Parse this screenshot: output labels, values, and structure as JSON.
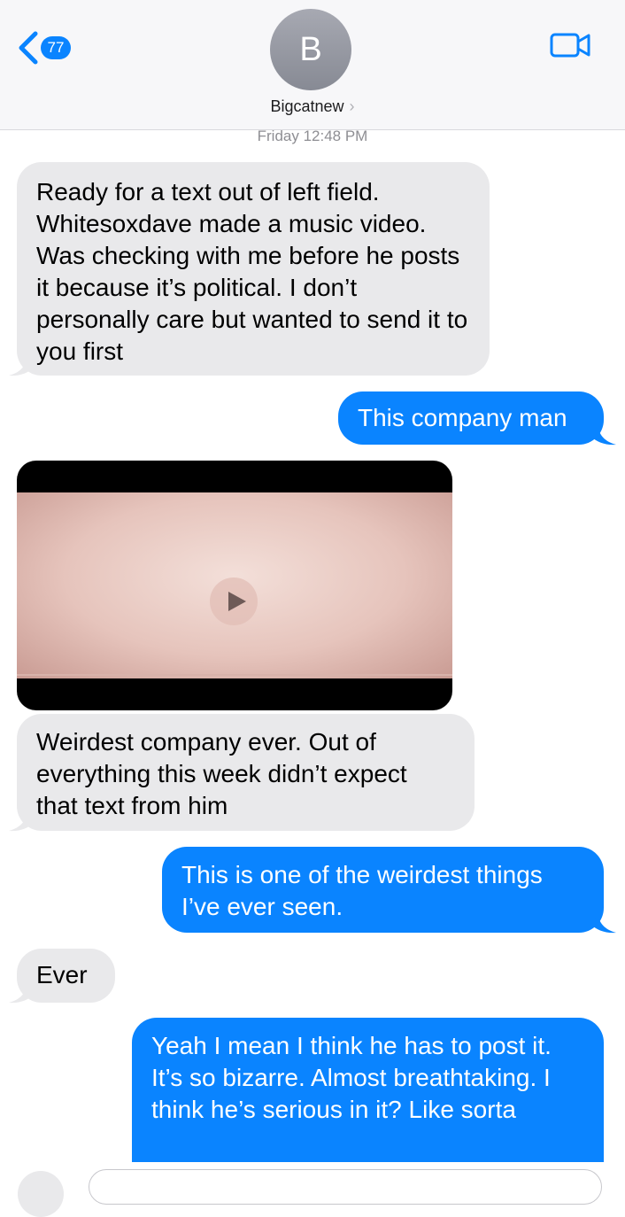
{
  "header": {
    "back_count": "77",
    "avatar_initial": "B",
    "contact_name": "Bigcatnew",
    "contact_chevron": "›",
    "back_icon": "chevron-left-icon",
    "video_call_icon": "video-camera-icon"
  },
  "timestamp": "Friday 12:48 PM",
  "messages": [
    {
      "direction": "incoming",
      "text": "Ready for a text out of left field. Whitesoxdave made a music video. Was checking with me before he posts it because it’s political. I don’t personally care but wanted to send it to you first"
    },
    {
      "direction": "outgoing",
      "text": "This company man"
    },
    {
      "direction": "incoming",
      "type": "video-attachment"
    },
    {
      "direction": "incoming",
      "text": "Weirdest company ever. Out of everything this week didn’t expect that text from him"
    },
    {
      "direction": "outgoing",
      "text": "This is one of the weirdest things I’ve ever seen."
    },
    {
      "direction": "incoming",
      "text": "Ever"
    },
    {
      "direction": "outgoing",
      "text": "Yeah I mean I think he has to post it. It’s so bizarre.   Almost breathtaking.  I think he’s serious in it? Like sorta"
    }
  ],
  "colors": {
    "incoming_bubble": "#e9e9eb",
    "outgoing_bubble": "#0a84ff",
    "accent": "#0a84ff"
  }
}
